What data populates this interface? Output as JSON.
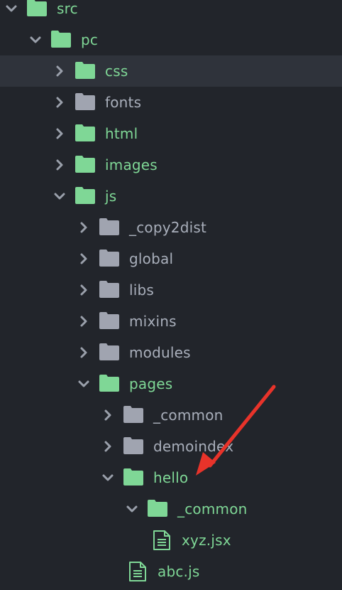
{
  "colors": {
    "background": "#22252b",
    "selected_row": "#2f333b",
    "folder_green": "#7fd796",
    "folder_gray": "#a0a4b0",
    "label_green": "#7fd796",
    "label_gray": "#a9afbb",
    "annotation_arrow": "#e8332a"
  },
  "tree": [
    {
      "name": "src",
      "kind": "folder",
      "depth": 0,
      "expanded": true,
      "status": "modified"
    },
    {
      "name": "pc",
      "kind": "folder",
      "depth": 1,
      "expanded": true,
      "status": "modified"
    },
    {
      "name": "css",
      "kind": "folder",
      "depth": 2,
      "expanded": false,
      "status": "modified",
      "selected": true
    },
    {
      "name": "fonts",
      "kind": "folder",
      "depth": 2,
      "expanded": false,
      "status": "unchanged"
    },
    {
      "name": "html",
      "kind": "folder",
      "depth": 2,
      "expanded": false,
      "status": "modified"
    },
    {
      "name": "images",
      "kind": "folder",
      "depth": 2,
      "expanded": false,
      "status": "modified"
    },
    {
      "name": "js",
      "kind": "folder",
      "depth": 2,
      "expanded": true,
      "status": "modified"
    },
    {
      "name": "_copy2dist",
      "kind": "folder",
      "depth": 3,
      "expanded": false,
      "status": "unchanged"
    },
    {
      "name": "global",
      "kind": "folder",
      "depth": 3,
      "expanded": false,
      "status": "unchanged"
    },
    {
      "name": "libs",
      "kind": "folder",
      "depth": 3,
      "expanded": false,
      "status": "unchanged"
    },
    {
      "name": "mixins",
      "kind": "folder",
      "depth": 3,
      "expanded": false,
      "status": "unchanged"
    },
    {
      "name": "modules",
      "kind": "folder",
      "depth": 3,
      "expanded": false,
      "status": "unchanged"
    },
    {
      "name": "pages",
      "kind": "folder",
      "depth": 3,
      "expanded": true,
      "status": "modified"
    },
    {
      "name": "_common",
      "kind": "folder",
      "depth": 4,
      "expanded": false,
      "status": "unchanged"
    },
    {
      "name": "demoindex",
      "kind": "folder",
      "depth": 4,
      "expanded": false,
      "status": "unchanged"
    },
    {
      "name": "hello",
      "kind": "folder",
      "depth": 4,
      "expanded": true,
      "status": "modified"
    },
    {
      "name": "_common",
      "kind": "folder",
      "depth": 5,
      "expanded": true,
      "status": "modified"
    },
    {
      "name": "xyz.jsx",
      "kind": "file",
      "depth": 6,
      "status": "modified"
    },
    {
      "name": "abc.js",
      "kind": "file",
      "depth": 5,
      "status": "modified"
    }
  ],
  "icons": {
    "expanded": "chevron-down-icon",
    "collapsed": "chevron-right-icon",
    "folder": "folder-icon",
    "file": "file-text-icon",
    "annotation": "red-arrow-icon"
  },
  "annotation": {
    "points_to": "hello"
  }
}
